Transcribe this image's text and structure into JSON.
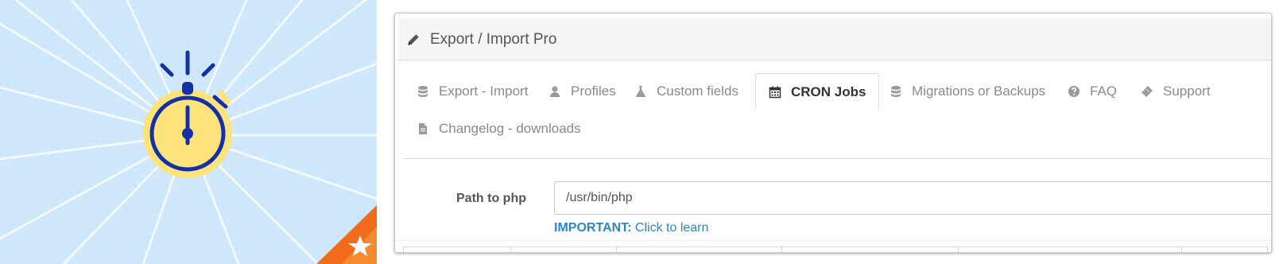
{
  "banner": {
    "background": "#cfe8fb",
    "icon": "stopwatch-icon",
    "badge_icon": "star-icon",
    "accent": "#f26b1d",
    "stopwatch_fill": "#fde37a",
    "stopwatch_stroke": "#1430a8"
  },
  "panel": {
    "title": "Export / Import Pro",
    "title_icon": "pencil-icon"
  },
  "tabs": [
    {
      "label": "Export - Import",
      "icon": "database-icon",
      "active": false
    },
    {
      "label": "Profiles",
      "icon": "user-icon",
      "active": false
    },
    {
      "label": "Custom fields",
      "icon": "flask-icon",
      "active": false
    },
    {
      "label": "CRON Jobs",
      "icon": "calendar-icon",
      "active": true
    },
    {
      "label": "Migrations or Backups",
      "icon": "database-icon",
      "active": false
    },
    {
      "label": "FAQ",
      "icon": "question-circle-icon",
      "active": false
    },
    {
      "label": "Support",
      "icon": "ticket-icon",
      "active": false
    },
    {
      "label": "Changelog - downloads",
      "icon": "file-icon",
      "active": false
    }
  ],
  "form": {
    "php_label": "Path to php",
    "php_value": "/usr/bin/php",
    "help_strong": "IMPORTANT:",
    "help_link": "Click to learn"
  }
}
